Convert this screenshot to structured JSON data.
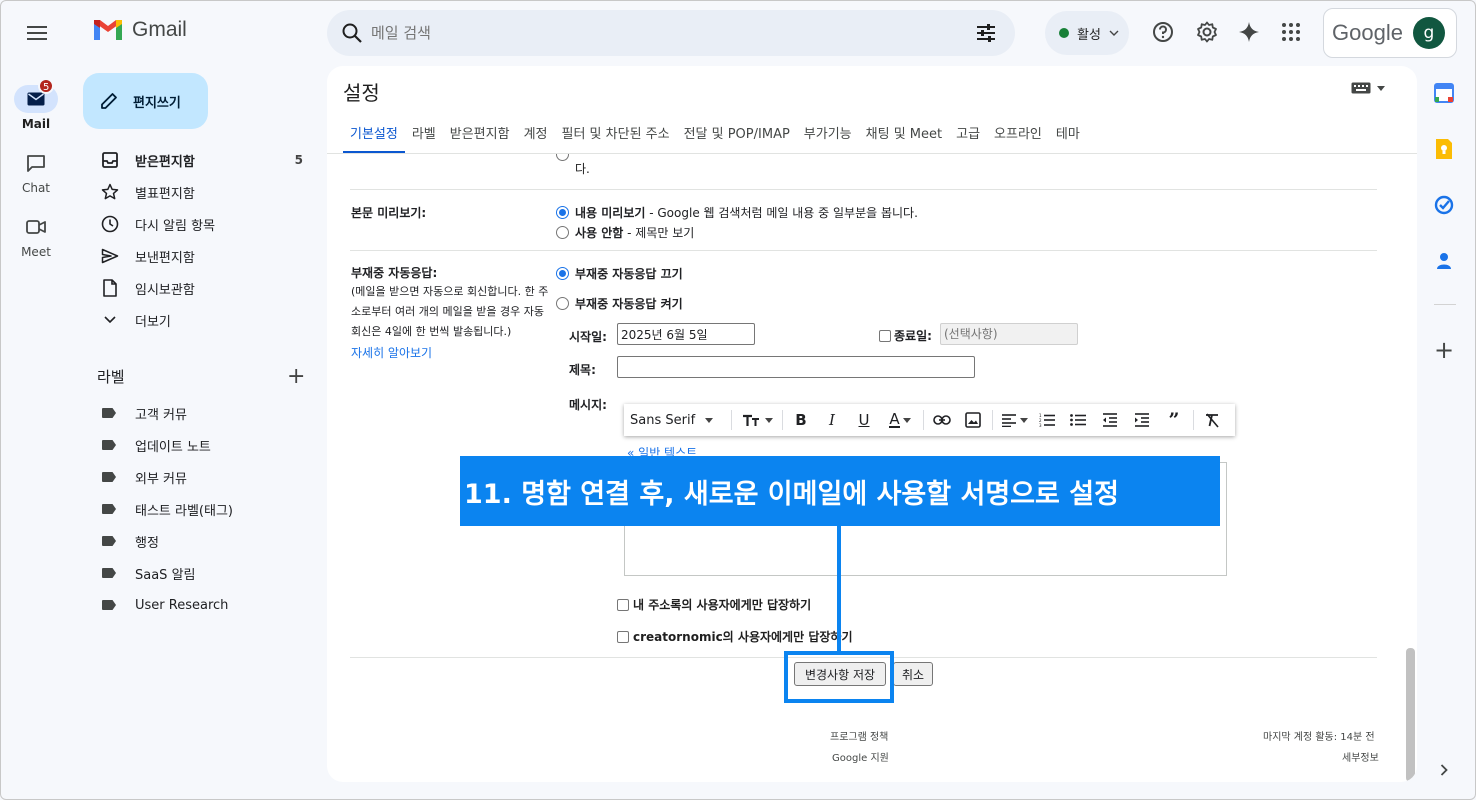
{
  "app": {
    "logo_text": "Gmail",
    "search_placeholder": "메일 검색",
    "status_label": "활성",
    "google_word": "Google",
    "avatar_letter": "g"
  },
  "rail": {
    "mail_label": "Mail",
    "mail_badge": "5",
    "chat_label": "Chat",
    "meet_label": "Meet"
  },
  "nav": {
    "compose_label": "편지쓰기",
    "items": [
      {
        "label": "받은편지함",
        "count": "5"
      },
      {
        "label": "별표편지함"
      },
      {
        "label": "다시 알림 항목"
      },
      {
        "label": "보낸편지함"
      },
      {
        "label": "임시보관함"
      },
      {
        "label": "더보기"
      }
    ],
    "labels_title": "라벨",
    "labels": [
      "고객 커뮤",
      "업데이트 노트",
      "외부 커뮤",
      "태스트 라벨(태그)",
      "행정",
      "SaaS 알림",
      "User Research"
    ]
  },
  "settings": {
    "title": "설정",
    "tabs": [
      "기본설정",
      "라벨",
      "받은편지함",
      "계정",
      "필터 및 차단된 주소",
      "전달 및 POP/IMAP",
      "부가기능",
      "채팅 및 Meet",
      "고급",
      "오프라인",
      "테마"
    ],
    "prev_row_tail": "다.",
    "preview": {
      "label": "본문 미리보기:",
      "opt1_bold": "내용 미리보기",
      "opt1_rest": " - Google 웹 검색처럼 메일 내용 중 일부분을 봅니다.",
      "opt2_bold": "사용 안함",
      "opt2_rest": " - 제목만 보기"
    },
    "vacation": {
      "label": "부재중 자동응답:",
      "desc_1": "(메일을 받으면 자동으로 회신합니다. 한 주",
      "desc_2": "소로부터 여러 개의 메일을 받을 경우 자동",
      "desc_3": "회신은 4일에 한 번씩 발송됩니다.)",
      "learn_more": "자세히 알아보기",
      "off_label": "부재중 자동응답 끄기",
      "on_label": "부재중 자동응답 켜기",
      "start_label": "시작일:",
      "start_value": "2025년 6월 5일",
      "end_label": "종료일:",
      "end_placeholder": "(선택사항)",
      "subject_label": "제목:",
      "message_label": "메시지:",
      "font_name": "Sans Serif",
      "plain_text_link": "« 일반 텍스트",
      "contacts_only": "내 주소록의 사용자에게만 답장하기",
      "domain_only": "creatornomic의 사용자에게만 답장하기"
    },
    "save_button": "변경사항 저장",
    "cancel_button": "취소"
  },
  "footer": {
    "policy": "프로그램 정책",
    "support": "Google 지원",
    "last_activity": "마지막 계정 활동: 14분 전",
    "details": "세부정보"
  },
  "annotation": {
    "step_text": "11. 명함 연결 후, 새로운 이메일에 사용할 서명으로 설정"
  },
  "colors": {
    "accent": "#0b57d0",
    "callout": "#0b84f0",
    "compose_bg": "#c2e7ff"
  }
}
